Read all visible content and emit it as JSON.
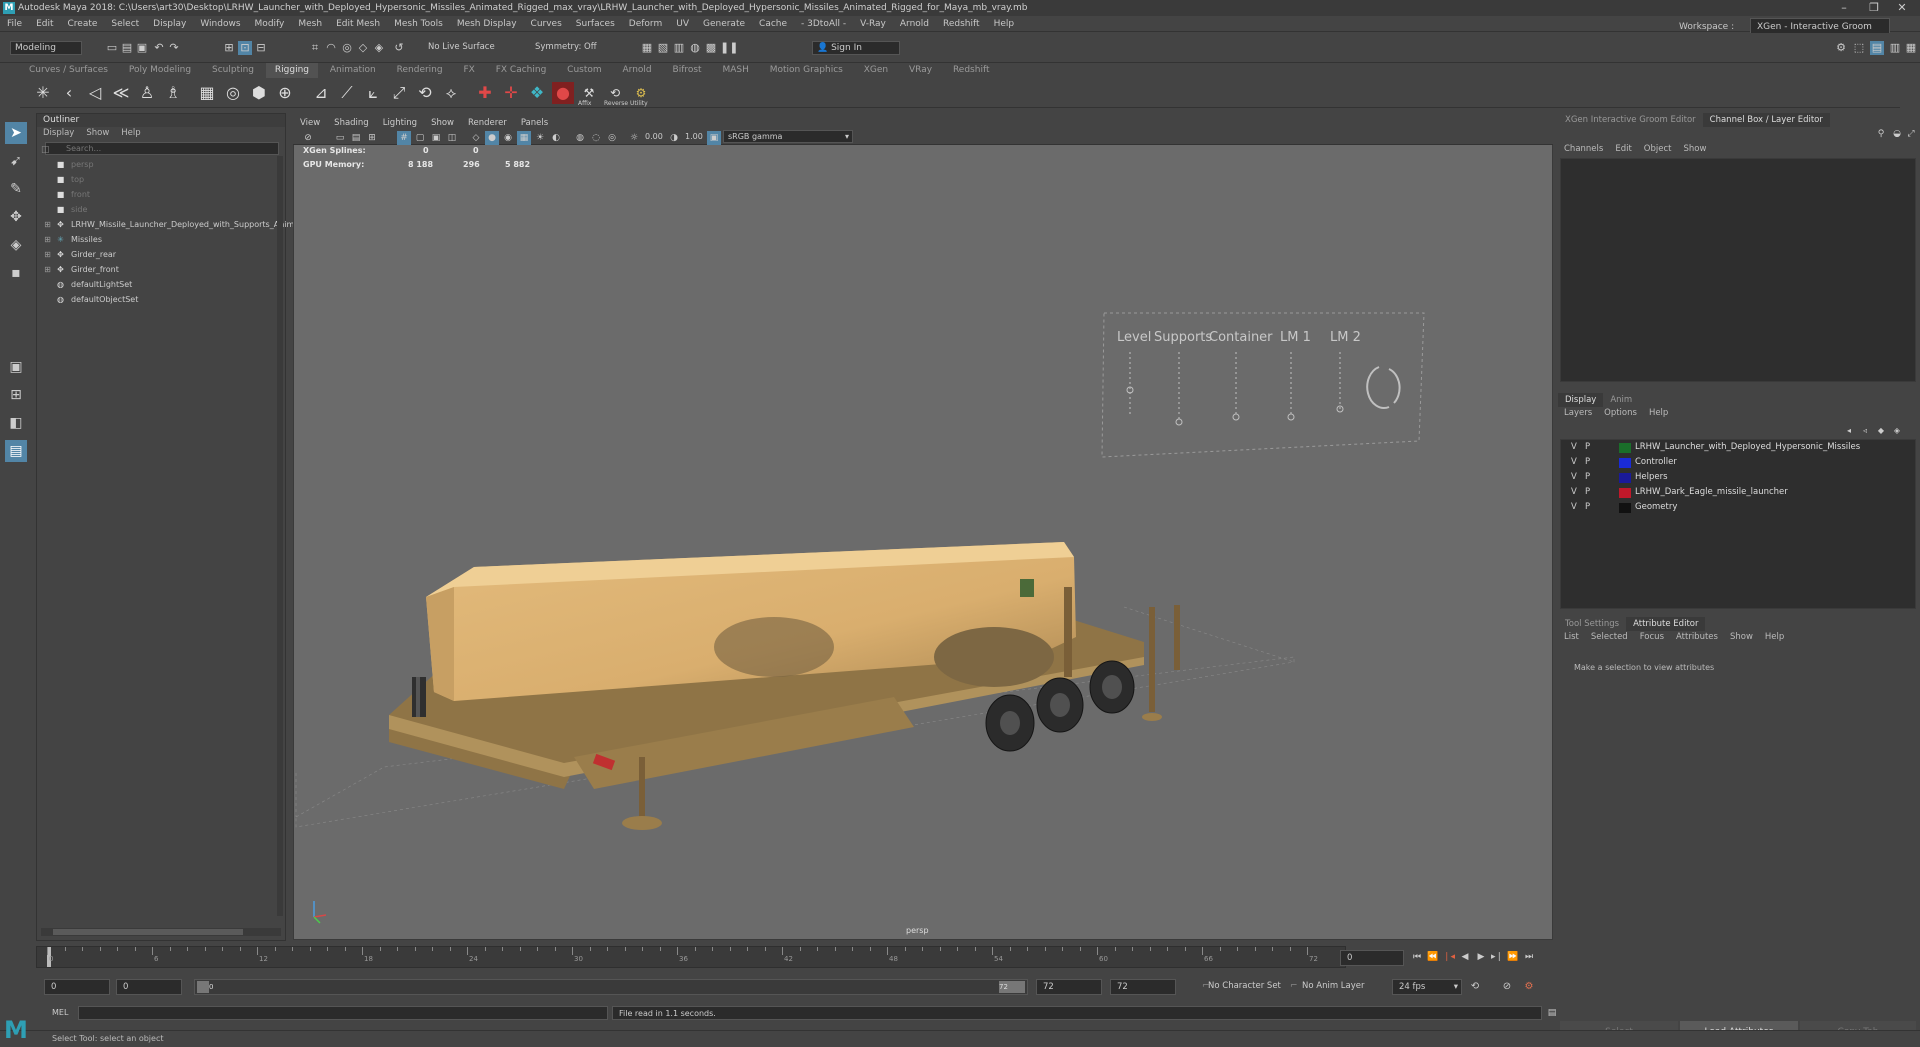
{
  "window": {
    "title": "Autodesk Maya 2018: C:\\Users\\art30\\Desktop\\LRHW_Launcher_with_Deployed_Hypersonic_Missiles_Animated_Rigged_max_vray\\LRHW_Launcher_with_Deployed_Hypersonic_Missiles_Animated_Rigged_for_Maya_mb_vray.mb",
    "logo": "M"
  },
  "menubar": {
    "items": [
      "File",
      "Edit",
      "Create",
      "Select",
      "Display",
      "Windows",
      "Modify",
      "Mesh",
      "Edit Mesh",
      "Mesh Tools",
      "Mesh Display",
      "Curves",
      "Surfaces",
      "Deform",
      "UV",
      "Generate",
      "Cache",
      "- 3DtoAll -",
      "V-Ray",
      "Arnold",
      "Redshift",
      "Help"
    ],
    "workspace_label": "Workspace :",
    "workspace_value": "XGen - Interactive Groom"
  },
  "statusline": {
    "menuset": "Modeling",
    "live_surface": "No Live Surface",
    "symmetry": "Symmetry: Off",
    "sign_in": "Sign In"
  },
  "shelf": {
    "tabs": [
      "Curves / Surfaces",
      "Poly Modeling",
      "Sculpting",
      "Rigging",
      "Animation",
      "Rendering",
      "FX",
      "FX Caching",
      "Custom",
      "Arnold",
      "Bifrost",
      "MASH",
      "Motion Graphics",
      "XGen",
      "VRay",
      "Redshift"
    ],
    "active_tab": "Rigging",
    "labels": [
      "Affix",
      "Reverse",
      "Utility"
    ]
  },
  "outliner": {
    "title": "Outliner",
    "menu": [
      "Display",
      "Show",
      "Help"
    ],
    "search_placeholder": "Search...",
    "cameras": [
      "persp",
      "top",
      "front",
      "side"
    ],
    "items": [
      "LRHW_Missile_Launcher_Deployed_with_Supports_Animated",
      "Missiles",
      "Girder_rear",
      "Girder_front",
      "defaultLightSet",
      "defaultObjectSet"
    ]
  },
  "viewport": {
    "menu": [
      "View",
      "Shading",
      "Lighting",
      "Show",
      "Renderer",
      "Panels"
    ],
    "exposure": "0.00",
    "gamma": "1.00",
    "colorspace": "sRGB gamma",
    "hud": {
      "xgen_label": "XGen Splines:",
      "xgen_v1": "0",
      "xgen_v2": "0",
      "gpu_label": "GPU Memory:",
      "gpu_v1": "8 188",
      "gpu_v2": "296",
      "gpu_v3": "5 882"
    },
    "controller_labels": [
      "Level",
      "Supports",
      "Container",
      "LM 1",
      "LM 2"
    ],
    "camera_name": "persp"
  },
  "right_panel": {
    "top_tabs": [
      "XGen Interactive Groom Editor",
      "Channel Box / Layer Editor"
    ],
    "channel_menu": [
      "Channels",
      "Edit",
      "Object",
      "Show"
    ],
    "layer_tabs": [
      "Display",
      "Anim"
    ],
    "layer_menu": [
      "Layers",
      "Options",
      "Help"
    ],
    "layers": [
      {
        "v": "V",
        "p": "P",
        "color": "#1a6e2a",
        "name": "LRHW_Launcher_with_Deployed_Hypersonic_Missiles"
      },
      {
        "v": "V",
        "p": "P",
        "color": "#1a2bd8",
        "name": "Controller"
      },
      {
        "v": "V",
        "p": "P",
        "color": "#1a1a9a",
        "name": "Helpers"
      },
      {
        "v": "V",
        "p": "P",
        "color": "#c0182a",
        "name": "LRHW_Dark_Eagle_missile_launcher"
      },
      {
        "v": "V",
        "p": "P",
        "color": "#111111",
        "name": "Geometry"
      }
    ],
    "attr_tabs": [
      "Tool Settings",
      "Attribute Editor"
    ],
    "attr_menu": [
      "List",
      "Selected",
      "Focus",
      "Attributes",
      "Show",
      "Help"
    ],
    "attr_message": "Make a selection to view attributes",
    "buttons": [
      "Select",
      "Load Attributes",
      "Copy Tab"
    ]
  },
  "timeline": {
    "ticks": [
      "0",
      "6",
      "12",
      "18",
      "24",
      "30",
      "36",
      "42",
      "48",
      "54",
      "60",
      "66",
      "72"
    ],
    "current_frame_field": "0",
    "range_start": "0",
    "range_start2": "0",
    "range_slider_start": "0",
    "range_slider_end": "72",
    "range_end": "72",
    "range_end2": "72",
    "character_set": "No Character Set",
    "anim_layer": "No Anim Layer",
    "fps": "24 fps"
  },
  "cmdline": {
    "label": "MEL",
    "result": "File read in  1.1 seconds."
  },
  "helpline": "Select Tool: select an object"
}
